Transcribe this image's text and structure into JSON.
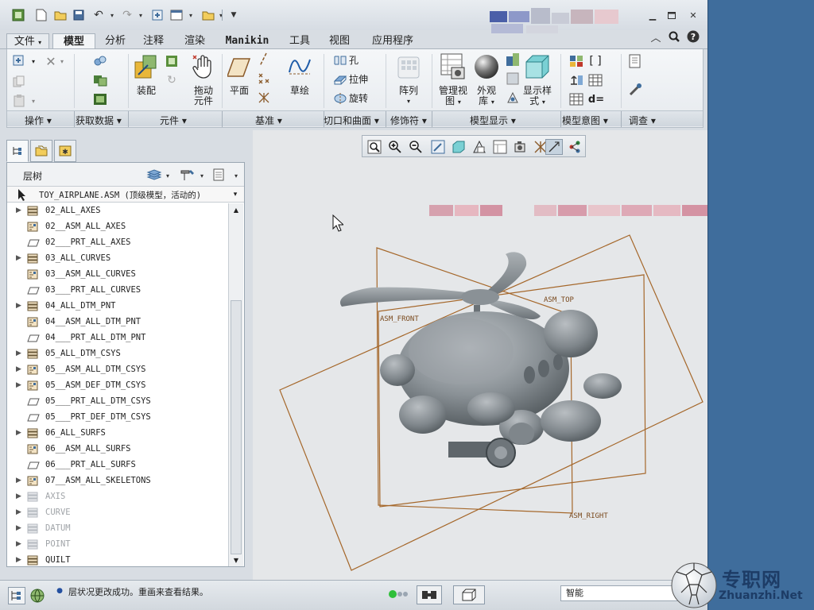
{
  "ribbon_tabs": [
    "文件",
    "模型",
    "分析",
    "注释",
    "渲染",
    "Manikin",
    "工具",
    "视图",
    "应用程序"
  ],
  "active_tab": "模型",
  "ribbon": {
    "buttons": {
      "assemble": "装配",
      "drag_components_line1": "拖动",
      "drag_components_line2": "元件",
      "plane": "平面",
      "sketch": "草绘",
      "hole": "孔",
      "extrude": "拉伸",
      "revolve": "旋转",
      "pattern": "阵列",
      "manage_views_line1": "管理视",
      "manage_views_line2": "图",
      "appearance_line1": "外观",
      "appearance_line2": "库",
      "display_style_line1": "显示样",
      "display_style_line2": "式"
    },
    "groups": [
      "操作",
      "获取数据",
      "元件",
      "基准",
      "切口和曲面",
      "修饰符",
      "模型显示",
      "模型意图",
      "调查"
    ]
  },
  "layer_tree": {
    "title": "层树",
    "model_selector": "TOY_AIRPLANE.ASM (顶级模型，活动的)",
    "rows": [
      {
        "label": "02_ALL_AXES",
        "kind": "layer",
        "expand": true,
        "dim": false
      },
      {
        "label": "02__ASM_ALL_AXES",
        "kind": "asm",
        "expand": false,
        "dim": false
      },
      {
        "label": "02___PRT_ALL_AXES",
        "kind": "prt",
        "expand": false,
        "dim": false
      },
      {
        "label": "03_ALL_CURVES",
        "kind": "layer",
        "expand": true,
        "dim": false
      },
      {
        "label": "03__ASM_ALL_CURVES",
        "kind": "asm",
        "expand": false,
        "dim": false
      },
      {
        "label": "03___PRT_ALL_CURVES",
        "kind": "prt",
        "expand": false,
        "dim": false
      },
      {
        "label": "04_ALL_DTM_PNT",
        "kind": "layer",
        "expand": true,
        "dim": false
      },
      {
        "label": "04__ASM_ALL_DTM_PNT",
        "kind": "asm",
        "expand": false,
        "dim": false
      },
      {
        "label": "04___PRT_ALL_DTM_PNT",
        "kind": "prt",
        "expand": false,
        "dim": false
      },
      {
        "label": "05_ALL_DTM_CSYS",
        "kind": "layer",
        "expand": true,
        "dim": false
      },
      {
        "label": "05__ASM_ALL_DTM_CSYS",
        "kind": "asm",
        "expand": true,
        "dim": false
      },
      {
        "label": "05__ASM_DEF_DTM_CSYS",
        "kind": "asm",
        "expand": true,
        "dim": false
      },
      {
        "label": "05___PRT_ALL_DTM_CSYS",
        "kind": "prt",
        "expand": false,
        "dim": false
      },
      {
        "label": "05___PRT_DEF_DTM_CSYS",
        "kind": "prt",
        "expand": false,
        "dim": false
      },
      {
        "label": "06_ALL_SURFS",
        "kind": "layer",
        "expand": true,
        "dim": false
      },
      {
        "label": "06__ASM_ALL_SURFS",
        "kind": "asm",
        "expand": false,
        "dim": false
      },
      {
        "label": "06___PRT_ALL_SURFS",
        "kind": "prt",
        "expand": false,
        "dim": false
      },
      {
        "label": "07__ASM_ALL_SKELETONS",
        "kind": "asm",
        "expand": true,
        "dim": false
      },
      {
        "label": "AXIS",
        "kind": "layer",
        "expand": true,
        "dim": true
      },
      {
        "label": "CURVE",
        "kind": "layer",
        "expand": true,
        "dim": true
      },
      {
        "label": "DATUM",
        "kind": "layer",
        "expand": true,
        "dim": true
      },
      {
        "label": "POINT",
        "kind": "layer",
        "expand": true,
        "dim": true
      },
      {
        "label": "QUILT",
        "kind": "layer",
        "expand": true,
        "dim": false
      }
    ]
  },
  "viewport": {
    "datum_labels": {
      "front": "ASM_FRONT",
      "top": "ASM_TOP",
      "right": "ASM_RIGHT"
    }
  },
  "status": {
    "message": "层状况更改成功。重画来查看结果。",
    "filter": "智能"
  },
  "watermark": {
    "title": "专职网",
    "url": "Zhuanzhi.Net"
  },
  "colors": {
    "datum_plane": "#a5672a",
    "model_gray": "#8a9196",
    "accent": "#3f6d9c"
  }
}
